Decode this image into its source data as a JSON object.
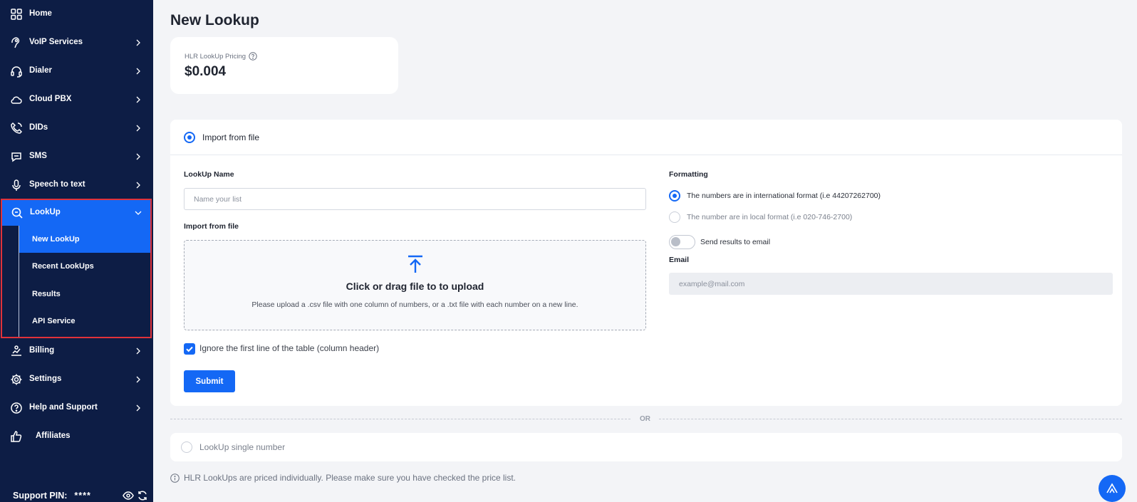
{
  "sidebar": {
    "items": [
      {
        "label": "Home",
        "icon": "grid-icon"
      },
      {
        "label": "VoIP Services",
        "icon": "voip-icon"
      },
      {
        "label": "Dialer",
        "icon": "headset-icon"
      },
      {
        "label": "Cloud PBX",
        "icon": "cloud-icon"
      },
      {
        "label": "DIDs",
        "icon": "phone-icon"
      },
      {
        "label": "SMS",
        "icon": "sms-icon"
      },
      {
        "label": "Speech to text",
        "icon": "microphone-icon"
      },
      {
        "label": "LookUp",
        "icon": "search-icon"
      },
      {
        "label": "Billing",
        "icon": "billing-icon"
      },
      {
        "label": "Settings",
        "icon": "gear-icon"
      },
      {
        "label": "Help and Support",
        "icon": "help-icon"
      },
      {
        "label": "Affiliates",
        "icon": "thumbs-up-icon"
      }
    ],
    "lookup_sub": [
      {
        "label": "New LookUp",
        "active": true
      },
      {
        "label": "Recent LookUps",
        "active": false
      },
      {
        "label": "Results",
        "active": false
      },
      {
        "label": "API Service",
        "active": false
      }
    ],
    "support_pin_label": "Support PIN:",
    "support_pin_value": "****"
  },
  "main": {
    "title": "New Lookup",
    "pricing": {
      "label": "HLR LookUp Pricing",
      "value": "$0.004"
    },
    "import": {
      "header_label": "Import from file",
      "name_label": "LookUp Name",
      "name_placeholder": "Name your list",
      "file_label": "Import from file",
      "dropzone_title": "Click or drag file to to upload",
      "dropzone_desc": "Please upload a .csv file with one column of numbers, or a .txt file with each number on a new line.",
      "ignore_header_label": "Ignore the first line of the table (column header)",
      "ignore_header_checked": true,
      "submit_label": "Submit",
      "formatting_label": "Formatting",
      "format_options": [
        {
          "label": "The numbers are in international format (i.e 44207262700)",
          "selected": true
        },
        {
          "label": "The number are in local format (i.e 020-746-2700)",
          "selected": false
        }
      ],
      "send_email_label": "Send results to email",
      "send_email_enabled": false,
      "email_label": "Email",
      "email_placeholder": "example@mail.com"
    },
    "or_label": "OR",
    "single_label": "LookUp single number",
    "note": "HLR LookUps are priced individually. Please make sure you have checked the price list."
  },
  "colors": {
    "sidebar_bg": "#0d1d45",
    "accent": "#1468f5",
    "highlight_border": "#e0323a",
    "page_bg": "#f3f4f7"
  }
}
